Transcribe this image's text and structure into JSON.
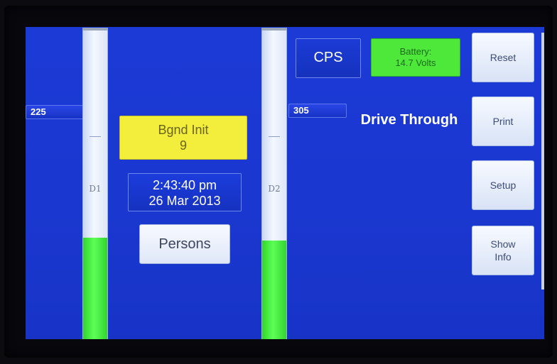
{
  "meters": [
    {
      "label": "D1",
      "readout": "225",
      "level": 0.33
    },
    {
      "label": "D2",
      "readout": "305",
      "level": 0.32
    }
  ],
  "status": {
    "bgnd_line1": "Bgnd Init",
    "bgnd_line2": "9",
    "time": "2:43:40 pm",
    "date": "26 Mar 2013",
    "mode": "Drive Through"
  },
  "buttons": {
    "persons": "Persons",
    "cps": "CPS",
    "reset": "Reset",
    "print": "Print",
    "setup": "Setup",
    "show_info": "Show\nInfo"
  },
  "battery": {
    "line1": "Battery:",
    "line2": "14.7 Volts"
  },
  "colors": {
    "screen": "#1a3bd4",
    "meter_fill": "#3fe23a",
    "status_yellow": "#f2ee3b",
    "battery_green": "#4de83a"
  }
}
